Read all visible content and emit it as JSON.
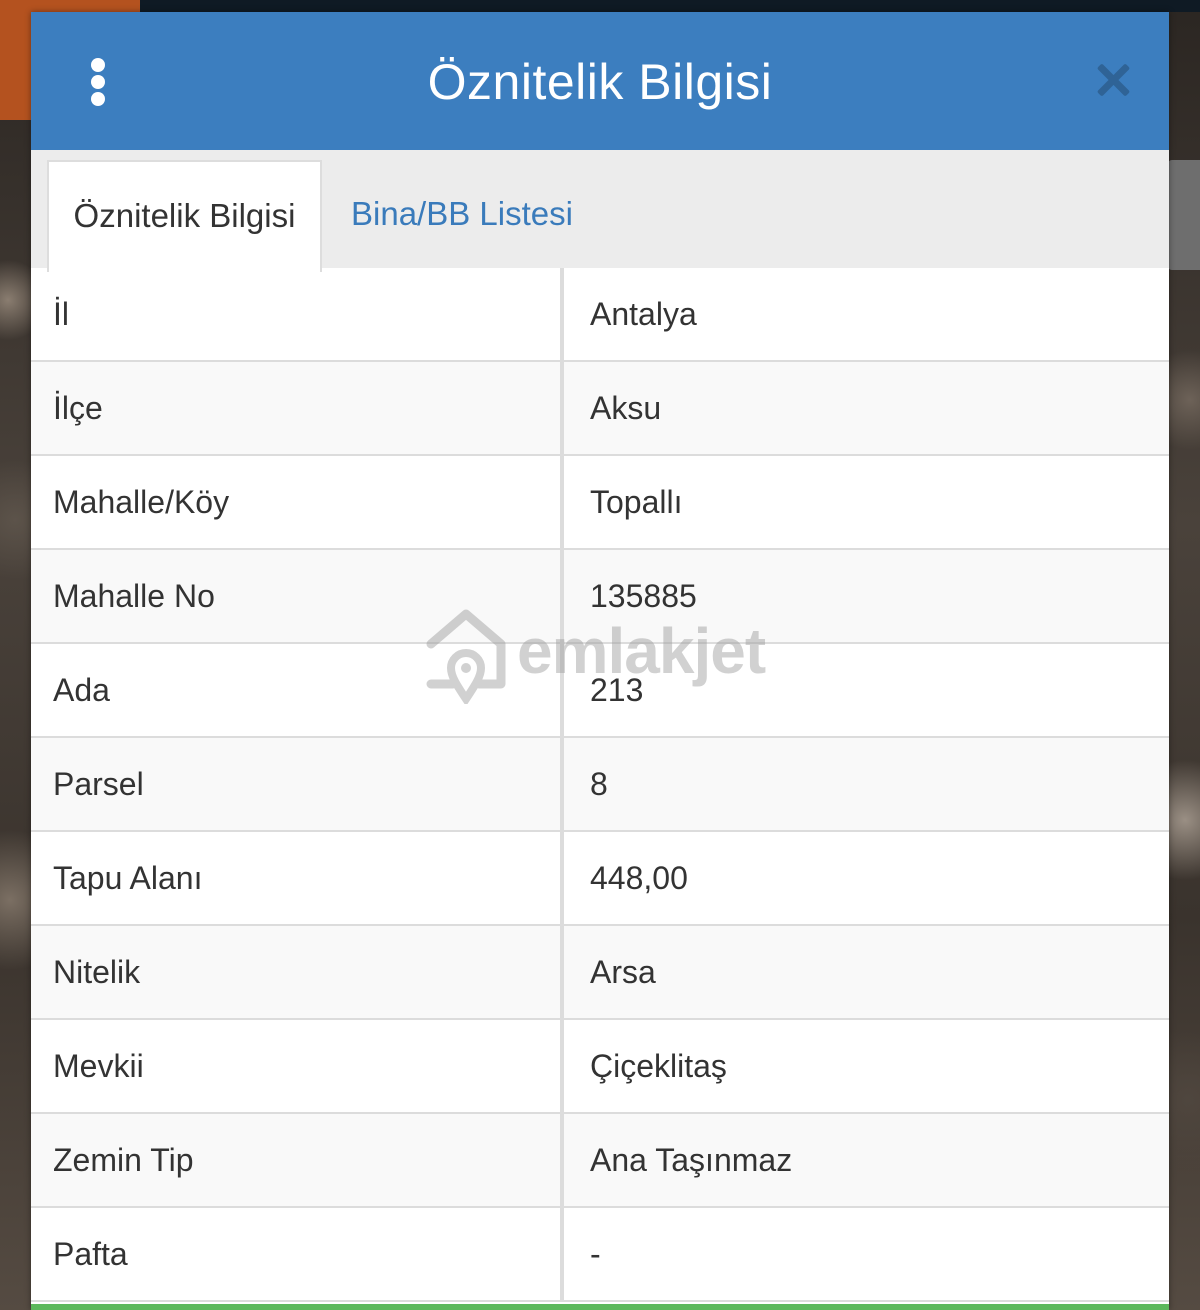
{
  "modal": {
    "title": "Öznitelik Bilgisi",
    "menu_icon": "vertical-dots-icon",
    "close_icon": "close-icon"
  },
  "tabs": [
    {
      "label": "Öznitelik Bilgisi",
      "active": true
    },
    {
      "label": "Bina/BB Listesi",
      "active": false
    }
  ],
  "attributes": [
    {
      "label": "İl",
      "value": "Antalya"
    },
    {
      "label": "İlçe",
      "value": "Aksu"
    },
    {
      "label": "Mahalle/Köy",
      "value": "Topallı"
    },
    {
      "label": "Mahalle No",
      "value": "135885"
    },
    {
      "label": "Ada",
      "value": "213"
    },
    {
      "label": "Parsel",
      "value": "8"
    },
    {
      "label": "Tapu Alanı",
      "value": "448,00"
    },
    {
      "label": "Nitelik",
      "value": "Arsa"
    },
    {
      "label": "Mevkii",
      "value": "Çiçeklitaş"
    },
    {
      "label": "Zemin Tip",
      "value": "Ana Taşınmaz"
    },
    {
      "label": "Pafta",
      "value": "-"
    }
  ],
  "watermark": {
    "text": "emlakjet",
    "icon": "emlakjet-logo-icon"
  },
  "colors": {
    "header": "#3c7ebf",
    "tab_link": "#3a7bbb",
    "close": "#2f6396",
    "bottom_accent": "#5cb85c"
  }
}
